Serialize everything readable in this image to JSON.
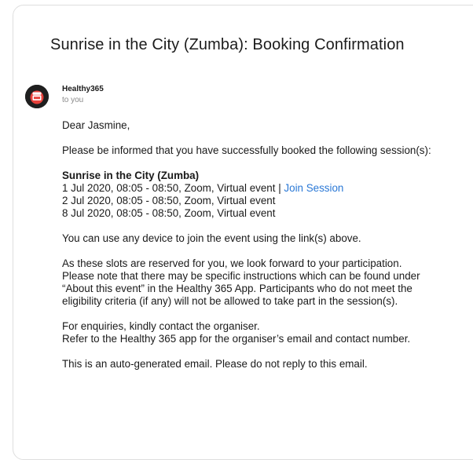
{
  "email": {
    "subject": "Sunrise in the City (Zumba): Booking Confirmation",
    "sender": "Healthy365",
    "recipient_label": "to you",
    "avatar_icon": "healthy365-logo-icon",
    "colors": {
      "link": "#2a78d6",
      "avatar_bg": "#1f1f1f",
      "logo_red": "#e8413b"
    },
    "greeting": "Dear Jasmine,",
    "intro": "Please be informed that you have successfully booked the following session(s):",
    "session": {
      "title": "Sunrise in the City (Zumba)",
      "slots": [
        "1 Jul 2020, 08:05 - 08:50, Zoom, Virtual event",
        "2 Jul 2020, 08:05 - 08:50, Zoom, Virtual event",
        "8 Jul 2020, 08:05 - 08:50, Zoom, Virtual event"
      ],
      "separator": "|",
      "join_link_label": "Join Session"
    },
    "device_note": "You can use any device to join the event using the link(s) above.",
    "reserved_note": "As these slots are reserved for you, we look forward to your participation. Please note that there may be specific instructions which can be found under “About this event” in the Healthy 365 App. Participants who do not meet the eligibility criteria (if any) will not be allowed to take part in the session(s).",
    "enquiry_line1": "For enquiries, kindly contact the organiser.",
    "enquiry_line2": "Refer to the Healthy 365 app for the organiser’s email and contact number.",
    "auto_note": "This is an auto-generated email. Please do not reply to this email."
  }
}
